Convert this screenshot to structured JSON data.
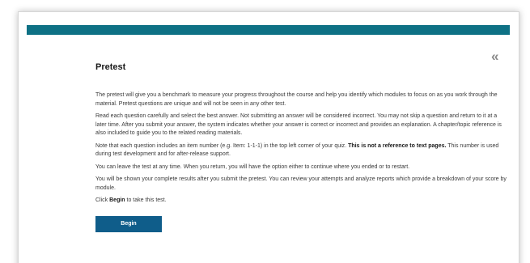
{
  "header": {
    "collapse_glyph": "«",
    "bar_color": "#0e7185"
  },
  "main": {
    "title": "Pretest",
    "paragraphs": [
      "The pretest will give you a benchmark to measure your progress throughout the course and help you identify which modules to focus on as you work through the material. Pretest questions are unique and will not be seen in any other test.",
      "Read each question carefully and select the best answer. Not submitting an answer will be considered incorrect. You may not skip a question and return to it at a later time. After you submit your answer, the system indicates whether your answer is correct or incorrect and provides an explanation. A chapter/topic reference is also included to guide you to the related reading materials.",
      {
        "before": "Note that each question includes an item number (e.g. Item: 1-1-1) in the top left corner of your quiz. ",
        "bold": "This is not a reference to text pages.",
        "after": " This number is used during test development and for after-release support."
      },
      "You can leave the test at any time. When you return, you will have the option either to continue where you ended or to restart.",
      "You will be shown your complete results after you submit the pretest. You can review your attempts and analyze reports which provide a breakdown of your score by module.",
      {
        "before": "Click ",
        "bold": "Begin",
        "after": " to take this test."
      }
    ],
    "begin_label": "Begin",
    "button_color": "#0f5d8a"
  }
}
